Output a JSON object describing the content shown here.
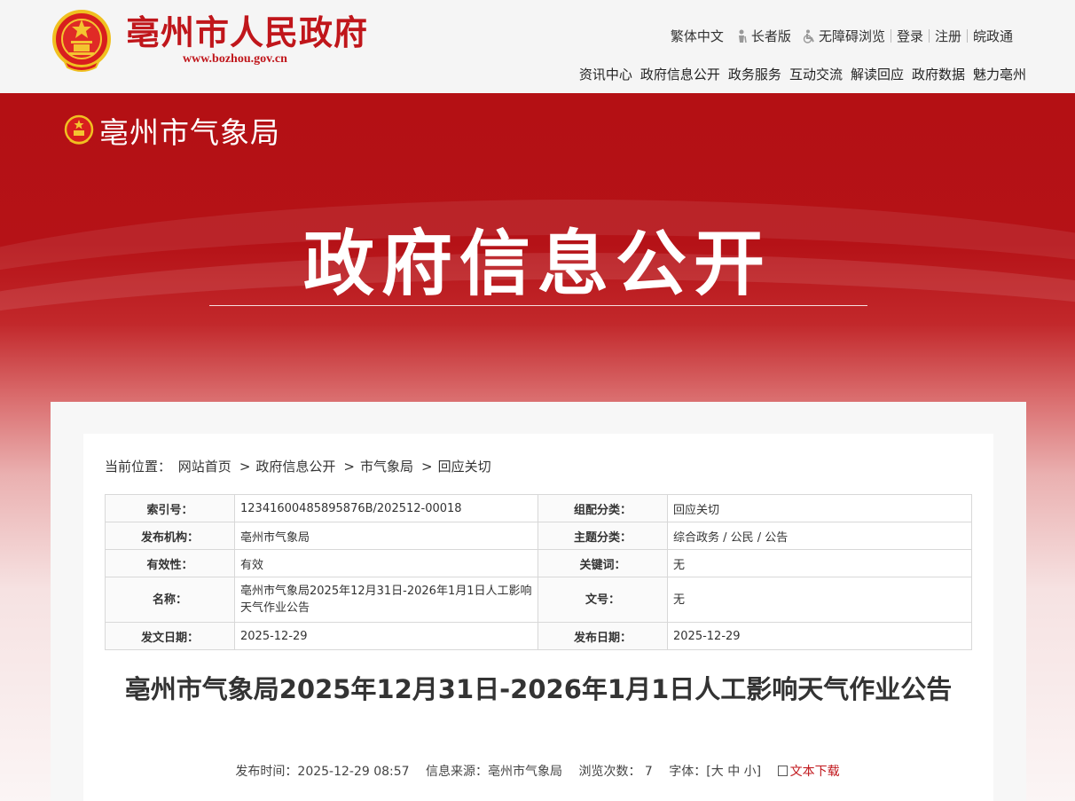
{
  "header": {
    "site_title": "亳州市人民政府",
    "site_url": "www.bozhou.gov.cn",
    "util_links": [
      "繁体中文",
      "长者版",
      "无障碍浏览",
      "登录",
      "注册",
      "皖政通"
    ],
    "nav": [
      "资讯中心",
      "政府信息公开",
      "政务服务",
      "互动交流",
      "解读回应",
      "政府数据",
      "魅力亳州"
    ]
  },
  "banner": {
    "dept_name": "亳州市气象局",
    "title": "政府信息公开"
  },
  "breadcrumb": {
    "prefix": "当前位置：",
    "items": [
      "网站首页",
      "政府信息公开",
      "市气象局",
      "回应关切"
    ],
    "sep": ">"
  },
  "meta_table": {
    "rows": [
      {
        "k1": "索引号：",
        "v1": "12341600485895876B/202512-00018",
        "k2": "组配分类：",
        "v2": "回应关切"
      },
      {
        "k1": "发布机构：",
        "v1": "亳州市气象局",
        "k2": "主题分类：",
        "v2": "综合政务 / 公民 / 公告"
      },
      {
        "k1": "有效性：",
        "v1": "有效",
        "k2": "关键词：",
        "v2": "无"
      },
      {
        "k1": "名称：",
        "v1": "亳州市气象局2025年12月31日-2026年1月1日人工影响天气作业公告",
        "k2": "文号：",
        "v2": "无"
      },
      {
        "k1": "发文日期：",
        "v1": "2025-12-29",
        "k2": "发布日期：",
        "v2": "2025-12-29"
      }
    ]
  },
  "article": {
    "title": "亳州市气象局2025年12月31日-2026年1月1日人工影响天气作业公告",
    "publish_time": "发布时间：2025-12-29 08:57",
    "source": "信息来源：亳州市气象局",
    "views": "浏览次数： 7",
    "font_size": "字体：[大 中 小]",
    "download": "文本下载"
  },
  "colors": {
    "brand_red": "#c0161b",
    "banner_red": "#b41014"
  },
  "icons": [
    "emblem-icon",
    "elder-icon",
    "accessibility-icon",
    "document-icon"
  ]
}
